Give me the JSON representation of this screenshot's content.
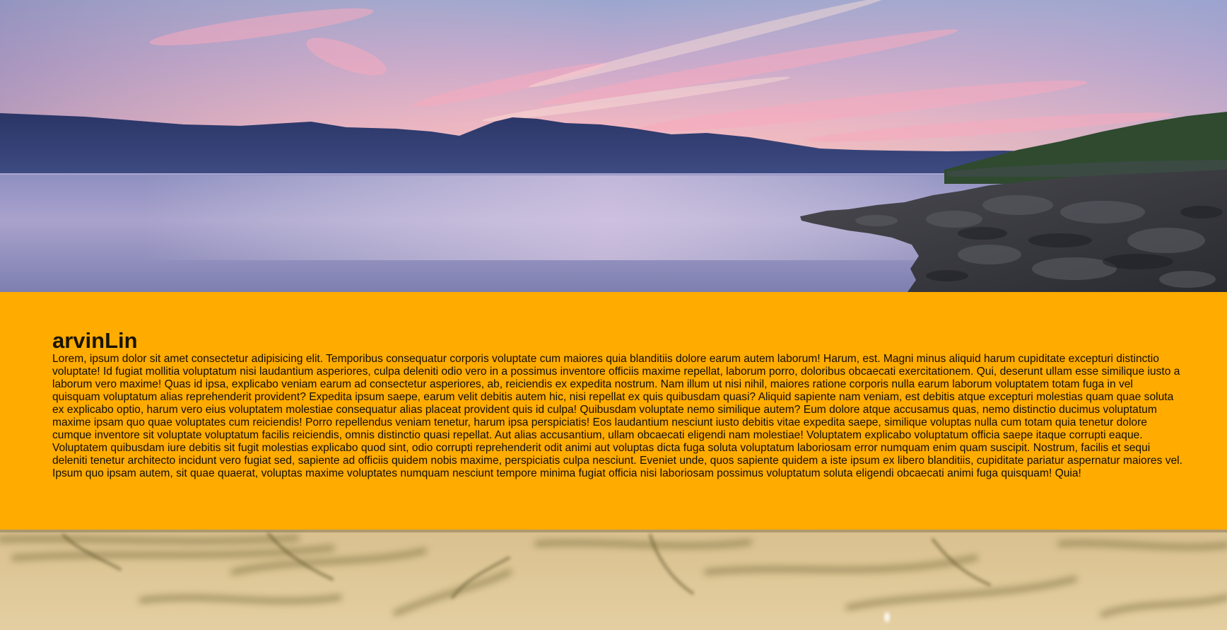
{
  "hero": {
    "image": "lake-sunset-photo"
  },
  "content": {
    "title": "arvinLin",
    "body": "Lorem, ipsum dolor sit amet consectetur adipisicing elit. Temporibus consequatur corporis voluptate cum maiores quia blanditiis dolore earum autem laborum! Harum, est. Magni minus aliquid harum cupiditate excepturi distinctio voluptate! Id fugiat mollitia voluptatum nisi laudantium asperiores, culpa deleniti odio vero in a possimus inventore officiis maxime repellat, laborum porro, doloribus obcaecati exercitationem. Qui, deserunt ullam esse similique iusto a laborum vero maxime! Quas id ipsa, explicabo veniam earum ad consectetur asperiores, ab, reiciendis ex expedita nostrum. Nam illum ut nisi nihil, maiores ratione corporis nulla earum laborum voluptatem totam fuga in vel quisquam voluptatum alias reprehenderit provident? Expedita ipsum saepe, earum velit debitis autem hic, nisi repellat ex quis quibusdam quasi? Aliquid sapiente nam veniam, est debitis atque excepturi molestias quam quae soluta ex explicabo optio, harum vero eius voluptatem molestiae consequatur alias placeat provident quis id culpa! Quibusdam voluptate nemo similique autem? Eum dolore atque accusamus quas, nemo distinctio ducimus voluptatum maxime ipsam quo quae voluptates cum reiciendis! Porro repellendus veniam tenetur, harum ipsa perspiciatis! Eos laudantium nesciunt iusto debitis vitae expedita saepe, similique voluptas nulla cum totam quia tenetur dolore cumque inventore sit voluptate voluptatum facilis reiciendis, omnis distinctio quasi repellat. Aut alias accusantium, ullam obcaecati eligendi nam molestiae! Voluptatem explicabo voluptatum officia saepe itaque corrupti eaque. Voluptatem quibusdam iure debitis sit fugit molestias explicabo quod sint, odio corrupti reprehenderit odit animi aut voluptas dicta fuga soluta voluptatum laboriosam error numquam enim quam suscipit. Nostrum, facilis et sequi deleniti tenetur architecto incidunt vero fugiat sed, sapiente ad officiis quidem nobis maxime, perspiciatis culpa nesciunt. Eveniet unde, quos sapiente quidem a iste ipsum ex libero blanditiis, cupiditate pariatur aspernatur maiores vel. Ipsum quo ipsam autem, sit quae quaerat, voluptas maxime voluptates numquam nesciunt tempore minima fugiat officia nisi laboriosam possimus voluptatum soluta eligendi obcaecati animi fuga quisquam! Quia!"
  },
  "footer_image": {
    "image": "blurred-sand-grass-photo"
  },
  "colors": {
    "band_background": "#ffab00",
    "text": "#120d00"
  }
}
